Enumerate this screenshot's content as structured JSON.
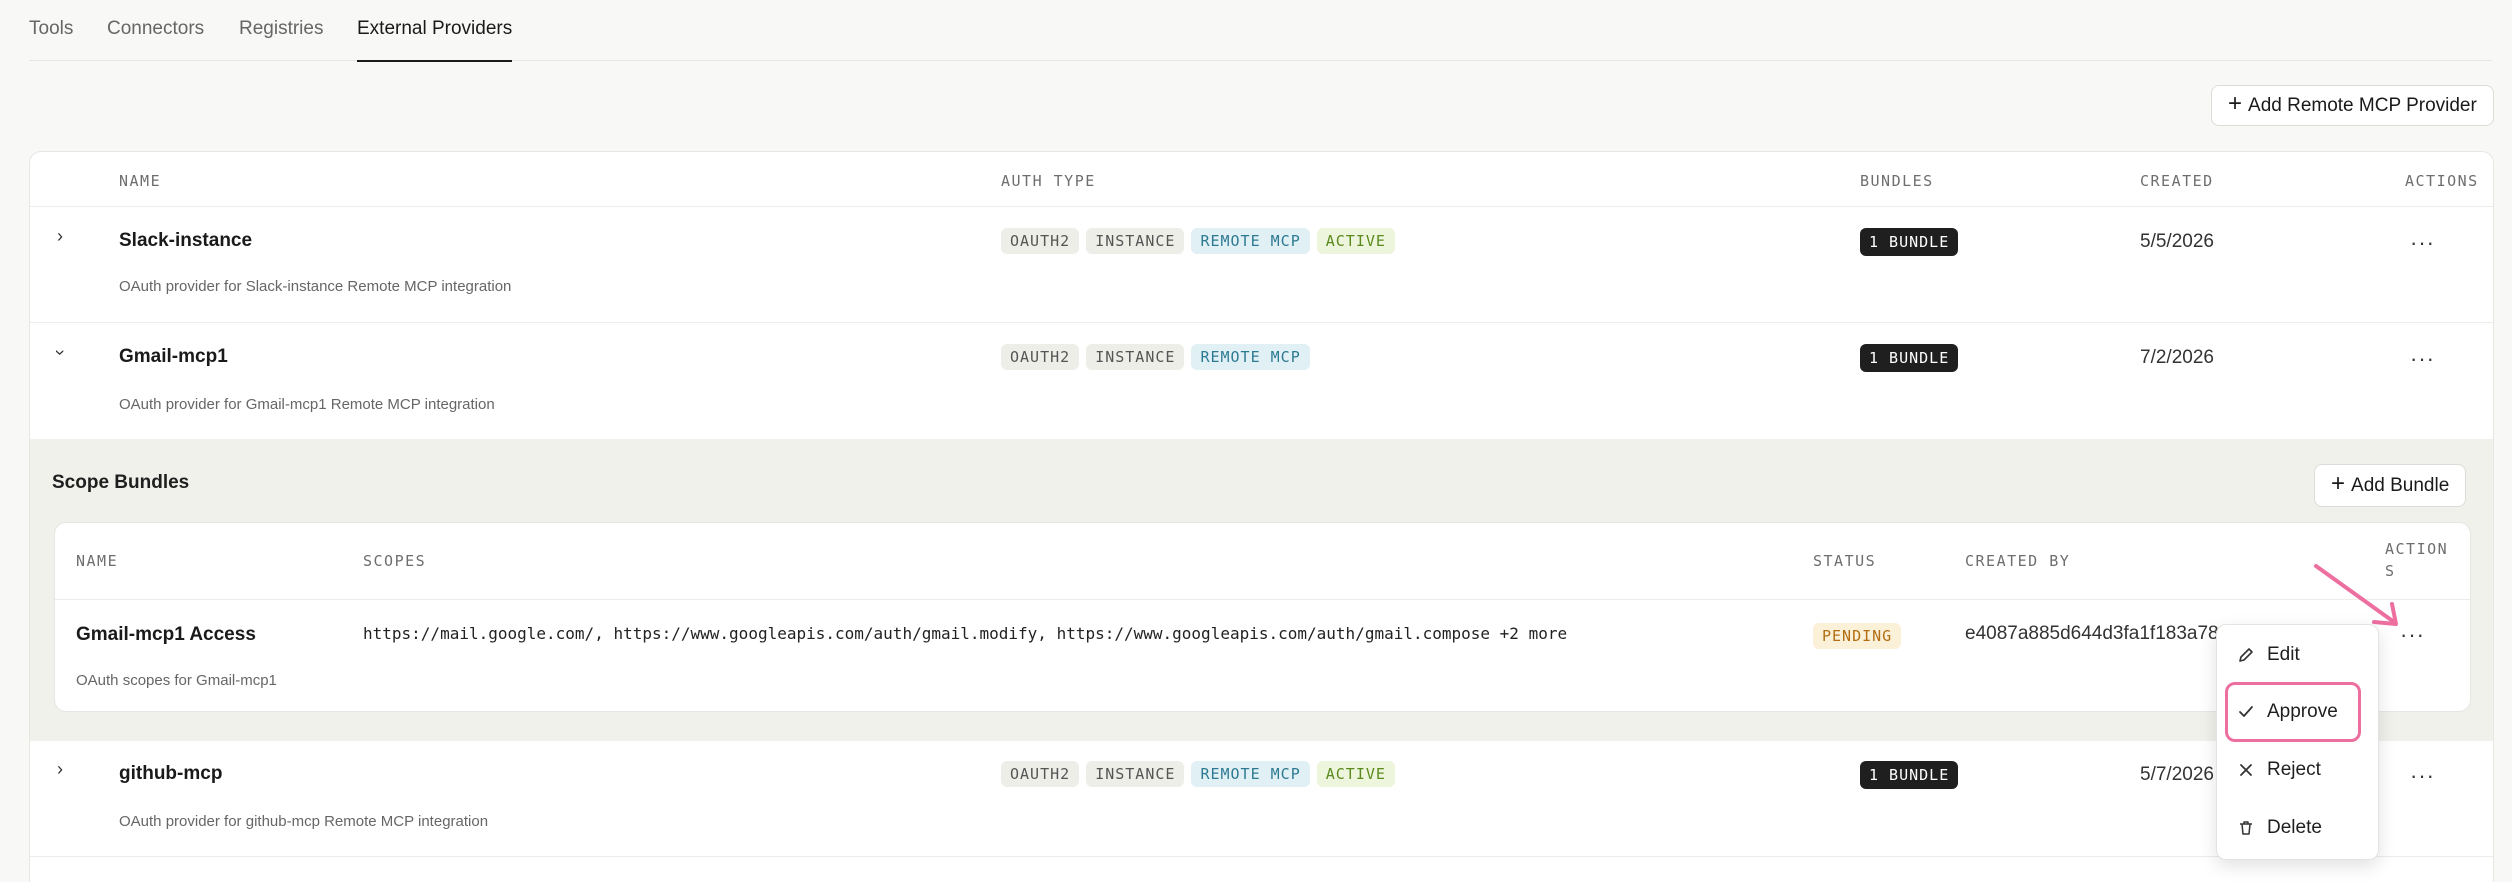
{
  "tabs": [
    {
      "label": "Tools"
    },
    {
      "label": "Connectors"
    },
    {
      "label": "Registries"
    },
    {
      "label": "External Providers",
      "active": true
    }
  ],
  "add_provider_label": "Add Remote MCP Provider",
  "table": {
    "headers": {
      "name": "NAME",
      "auth_type": "AUTH TYPE",
      "bundles": "BUNDLES",
      "created": "CREATED",
      "actions": "ACTIONS"
    },
    "rows": [
      {
        "chevron": "›",
        "name": "Slack-instance",
        "description": "OAuth provider for Slack-instance Remote MCP integration",
        "badges": [
          "OAUTH2",
          "INSTANCE",
          "REMOTE MCP",
          "ACTIVE"
        ],
        "bundles": "1 BUNDLE",
        "created": "5/5/2026",
        "actions": "···"
      },
      {
        "chevron": "›",
        "name": "Gmail-mcp1",
        "description": "OAuth provider for Gmail-mcp1 Remote MCP integration",
        "badges": [
          "OAUTH2",
          "INSTANCE",
          "REMOTE MCP"
        ],
        "bundles": "1 BUNDLE",
        "created": "7/2/2026",
        "actions": "···"
      },
      {
        "chevron": "›",
        "name": "github-mcp",
        "description": "OAuth provider for github-mcp Remote MCP integration",
        "badges": [
          "OAUTH2",
          "INSTANCE",
          "REMOTE MCP",
          "ACTIVE"
        ],
        "bundles": "1 BUNDLE",
        "created": "5/7/2026",
        "actions": "···"
      }
    ]
  },
  "scope_bundles": {
    "title": "Scope Bundles",
    "add_label": "Add Bundle",
    "headers": {
      "name": "NAME",
      "scopes": "SCOPES",
      "status": "STATUS",
      "created_by": "CREATED BY",
      "actions_1": "ACTION",
      "actions_2": "S"
    },
    "row": {
      "name": "Gmail-mcp1 Access",
      "description": "OAuth scopes for Gmail-mcp1",
      "scopes": "https://mail.google.com/, https://www.googleapis.com/auth/gmail.modify, https://www.googleapis.com/auth/gmail.compose +2 more",
      "status": "PENDING",
      "created_by": "e4087a885d644d3fa1f183a78",
      "actions": "···"
    }
  },
  "menu": {
    "items": [
      {
        "label": "Edit",
        "icon": "pencil-icon"
      },
      {
        "label": "Approve",
        "icon": "check-icon"
      },
      {
        "label": "Reject",
        "icon": "x-icon"
      },
      {
        "label": "Delete",
        "icon": "trash-icon"
      }
    ]
  },
  "colors": {
    "accent_highlight": "#ec6fa0",
    "remote_badge": "#2c7a91",
    "active_badge": "#5b8a1f",
    "pending_badge": "#b26e10"
  }
}
